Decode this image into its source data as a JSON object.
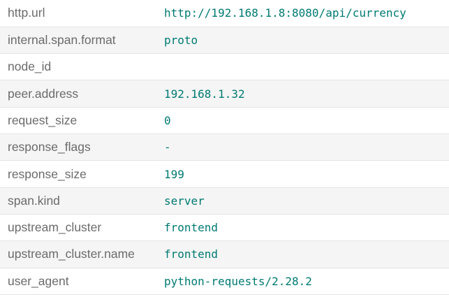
{
  "tags": [
    {
      "key": "http.url",
      "value": "http://192.168.1.8:8080/api/currency"
    },
    {
      "key": "internal.span.format",
      "value": "proto"
    },
    {
      "key": "node_id",
      "value": ""
    },
    {
      "key": "peer.address",
      "value": "192.168.1.32"
    },
    {
      "key": "request_size",
      "value": "0"
    },
    {
      "key": "response_flags",
      "value": "-"
    },
    {
      "key": "response_size",
      "value": "199"
    },
    {
      "key": "span.kind",
      "value": "server"
    },
    {
      "key": "upstream_cluster",
      "value": "frontend"
    },
    {
      "key": "upstream_cluster.name",
      "value": "frontend"
    },
    {
      "key": "user_agent",
      "value": "python-requests/2.28.2"
    }
  ],
  "colors": {
    "key_text": "#6b6b6b",
    "value_text": "#007a72",
    "row_alt_bg": "#f5f5f5",
    "divider": "#e4e4e4"
  }
}
